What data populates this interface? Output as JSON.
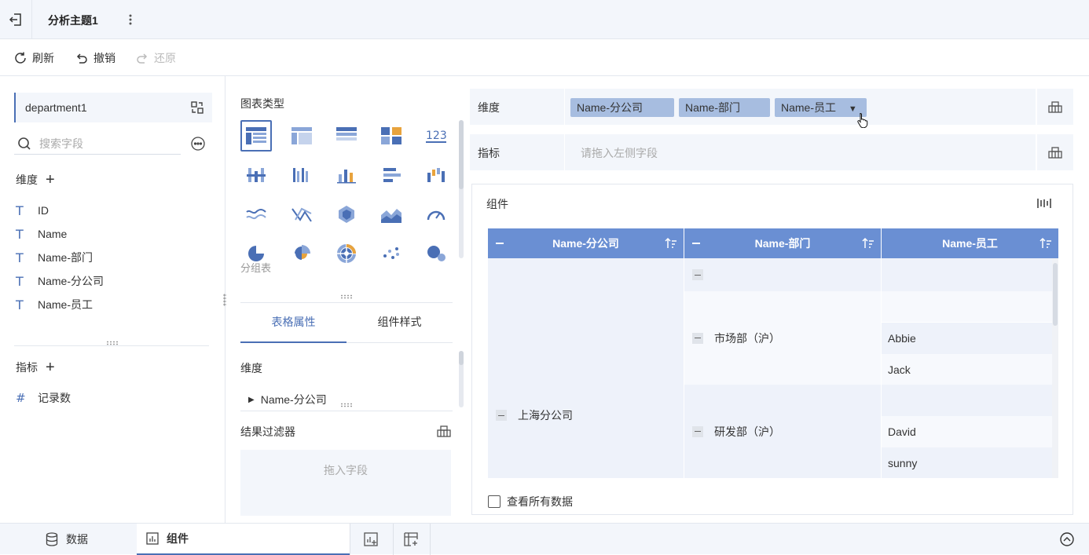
{
  "topbar": {
    "title": "分析主题1"
  },
  "toolbar": {
    "refresh": "刷新",
    "undo": "撤销",
    "redo": "还原"
  },
  "left": {
    "dataset": "department1",
    "search_placeholder": "搜索字段",
    "dimension_header": "维度",
    "dimension_fields": [
      "ID",
      "Name",
      "Name-部门",
      "Name-分公司",
      "Name-员工"
    ],
    "measure_header": "指标",
    "measure_fields": [
      "记录数"
    ]
  },
  "middle": {
    "chart_type_title": "图表类型",
    "selected_chart_label": "分组表",
    "tabs": [
      "表格属性",
      "组件样式"
    ],
    "dimension_label": "维度",
    "dimension_item": "Name-分公司",
    "filter_label": "结果过滤器",
    "filter_drop": "拖入字段"
  },
  "shelves": {
    "dimension_label": "维度",
    "dimension_pills": [
      "Name-分公司",
      "Name-部门",
      "Name-员工"
    ],
    "measure_label": "指标",
    "measure_placeholder": "请拖入左侧字段"
  },
  "widget": {
    "title": "组件",
    "headers": [
      "Name-分公司",
      "Name-部门",
      "Name-员工"
    ],
    "branch": "上海分公司",
    "departments": [
      "市场部（沪）",
      "研发部（沪）"
    ],
    "employees": [
      "Abbie",
      "Jack",
      "David",
      "sunny"
    ],
    "show_all": "查看所有数据"
  },
  "bottom": {
    "tabs": [
      "数据",
      "组件"
    ]
  },
  "colors": {
    "accent": "#4a6fb5",
    "header": "#6a8fd3",
    "pill": "#a7bde0"
  }
}
